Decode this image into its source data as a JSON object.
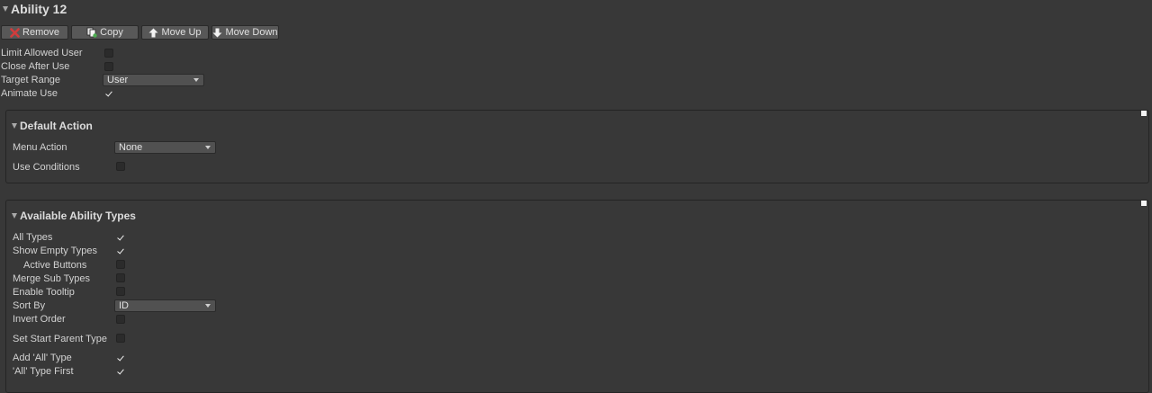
{
  "header": {
    "title": "Ability 12"
  },
  "toolbar": {
    "remove": "Remove",
    "copy": "Copy",
    "move_up": "Move Up",
    "move_down": "Move Down"
  },
  "top_fields": {
    "limit_allowed_user": {
      "label": "Limit Allowed User",
      "checked": false
    },
    "close_after_use": {
      "label": "Close After Use",
      "checked": false
    },
    "target_range": {
      "label": "Target Range",
      "value": "User"
    },
    "animate_use": {
      "label": "Animate Use",
      "checked": true
    }
  },
  "default_action": {
    "title": "Default Action",
    "menu_action": {
      "label": "Menu Action",
      "value": "None"
    },
    "use_conditions": {
      "label": "Use Conditions",
      "checked": false
    }
  },
  "available_types": {
    "title": "Available Ability Types",
    "all_types": {
      "label": "All Types",
      "checked": true
    },
    "show_empty_types": {
      "label": "Show Empty Types",
      "checked": true
    },
    "active_buttons": {
      "label": "Active Buttons",
      "checked": false
    },
    "merge_sub_types": {
      "label": "Merge Sub Types",
      "checked": false
    },
    "enable_tooltip": {
      "label": "Enable Tooltip",
      "checked": false
    },
    "sort_by": {
      "label": "Sort By",
      "value": "ID"
    },
    "invert_order": {
      "label": "Invert Order",
      "checked": false
    },
    "set_start_parent_type": {
      "label": "Set Start Parent Type",
      "checked": false
    },
    "add_all_type": {
      "label": "Add 'All' Type",
      "checked": true
    },
    "all_type_first": {
      "label": "'All' Type First",
      "checked": true
    }
  },
  "colors": {
    "background": "#383838",
    "button": "#585858",
    "remove_icon": "#d23c3c",
    "copy_icon_accent": "#4caf50"
  },
  "icons": {
    "remove": "red-x-icon",
    "copy": "copy-document-icon",
    "move_up": "arrow-up-icon",
    "move_down": "arrow-down-icon"
  }
}
